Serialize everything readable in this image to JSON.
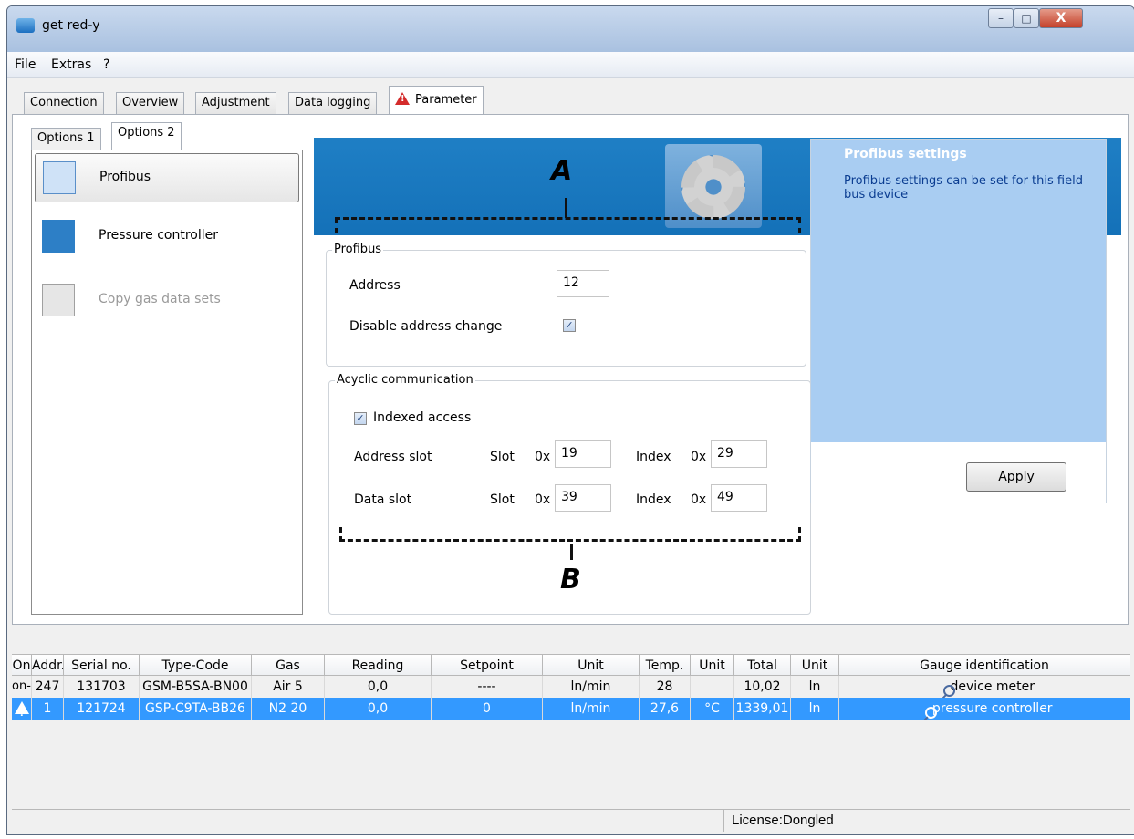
{
  "window": {
    "title": "get red-y",
    "min_label": "–",
    "max_label": "□",
    "close_label": "X"
  },
  "menu": [
    "File",
    "Extras",
    "?"
  ],
  "tabs": [
    "Connection",
    "Overview",
    "Adjustment",
    "Data logging",
    "Parameter"
  ],
  "subtabs": [
    "Options 1",
    "Options 2"
  ],
  "nav": [
    {
      "label": "Profibus",
      "icon": "profibus-icon"
    },
    {
      "label": "Pressure controller",
      "icon": "pressure-controller-icon"
    },
    {
      "label": "Copy gas data sets",
      "icon": "copy-gas-data-icon"
    }
  ],
  "profibus": {
    "group_label": "Profibus",
    "address_label": "Address",
    "address_value": "12",
    "disable_label": "Disable address change",
    "disable_checked": "✓"
  },
  "acyclic": {
    "group_label": "Acyclic communication",
    "indexed_label": "Indexed access",
    "indexed_checked": "✓",
    "address_slot_label": "Address slot",
    "data_slot_label": "Data slot",
    "slot_label": "Slot",
    "index_label": "Index",
    "hex_prefix": "0x",
    "address_slot_value": "19",
    "address_index_value": "29",
    "data_slot_value": "39",
    "data_index_value": "49"
  },
  "info": {
    "title": "Profibus settings",
    "text": "Profibus settings can be set for this field bus device",
    "apply_label": "Apply"
  },
  "markers": {
    "a": "A",
    "b": "B"
  },
  "grid": {
    "columns": [
      "On",
      "Addr.",
      "Serial no.",
      "Type-Code",
      "Gas",
      "Reading",
      "Setpoint",
      "Unit",
      "Temp.",
      "Unit",
      "Total",
      "Unit",
      "Gauge identification"
    ],
    "rows": [
      [
        "on-",
        "247",
        "131703",
        "GSM-B5SA-BN00",
        "Air 5",
        "0,0",
        "----",
        "ln/min",
        "28",
        "",
        "10,02",
        "ln",
        "device meter"
      ],
      [
        "",
        "1",
        "121724",
        "GSP-C9TA-BB26",
        "N2 20",
        "0,0",
        "0",
        "ln/min",
        "27,6",
        "°C",
        "1339,01",
        "ln",
        "pressure controller"
      ]
    ]
  },
  "status": {
    "license": "License:Dongled"
  }
}
